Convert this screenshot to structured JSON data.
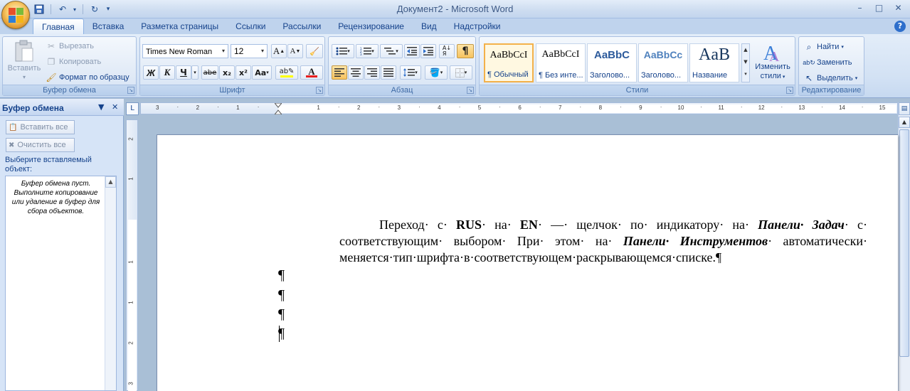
{
  "window": {
    "title": "Документ2 - Microsoft Word",
    "controls": {
      "minimize": "–",
      "maximize": "□",
      "close": "✕"
    }
  },
  "tabs": [
    {
      "label": "Главная",
      "active": true
    },
    {
      "label": "Вставка"
    },
    {
      "label": "Разметка страницы"
    },
    {
      "label": "Ссылки"
    },
    {
      "label": "Рассылки"
    },
    {
      "label": "Рецензирование"
    },
    {
      "label": "Вид"
    },
    {
      "label": "Надстройки"
    }
  ],
  "ribbon": {
    "clipboard": {
      "label": "Буфер обмена",
      "paste": "Вставить",
      "cut": "Вырезать",
      "copy": "Копировать",
      "format_painter": "Формат по образцу"
    },
    "font": {
      "label": "Шрифт",
      "font_name": "Times New Roman",
      "font_size": "12",
      "bold": "Ж",
      "italic": "К",
      "underline": "Ч",
      "strike": "abe",
      "subscript": "x₂",
      "superscript": "x²",
      "change_case": "Aa"
    },
    "paragraph": {
      "label": "Абзац"
    },
    "styles": {
      "label": "Стили",
      "tiles": [
        {
          "sample": "AaBbCcI",
          "name": "¶ Обычный",
          "selected": true
        },
        {
          "sample": "AaBbCcI",
          "name": "¶ Без инте..."
        },
        {
          "sample": "AaBbC",
          "name": "Заголово..."
        },
        {
          "sample": "AaBbCc",
          "name": "Заголово..."
        },
        {
          "sample": "AaB",
          "name": "Название"
        }
      ],
      "change_styles_line1": "Изменить",
      "change_styles_line2": "стили"
    },
    "editing": {
      "label": "Редактирование",
      "find": "Найти",
      "replace": "Заменить",
      "select": "Выделить"
    }
  },
  "task_pane": {
    "title": "Буфер обмена",
    "paste_all": "Вставить все",
    "clear_all": "Очистить все",
    "prompt": "Выберите вставляемый объект:",
    "empty_message": "Буфер обмена пуст. Выполните копирование или удаление в буфер для сбора объектов."
  },
  "ruler": {
    "h_numbers": [
      "3",
      "2",
      "1",
      "1",
      "2",
      "3",
      "4",
      "5",
      "6",
      "7",
      "8",
      "9",
      "10",
      "11",
      "12",
      "13",
      "14",
      "15"
    ],
    "v_numbers": [
      "2",
      "1",
      "1",
      "1",
      "2",
      "3",
      "4"
    ]
  },
  "document": {
    "p1": "Переход· с· ",
    "rus": "RUS",
    "p2": "· на· ",
    "en": "EN",
    "p3": "· —· щелчок· по· индикатору· на· ",
    "panel_tasks": "Панели· Задач",
    "p4": "· с· соответствующим· выбором· При· этом· на· ",
    "panel_tools": "Панели· Инструментов",
    "p5": "· автоматически· меняется·тип·шрифта·в·соответствующем·раскрывающемся·списке.¶",
    "empty_marks": [
      "¶",
      "¶",
      "¶",
      "¶"
    ]
  },
  "colors": {
    "ribbon_text": "#15428b",
    "highlight": "#f3b14a",
    "font_color_bar": "#e81e1e",
    "highlight_bar": "#ffff00"
  }
}
